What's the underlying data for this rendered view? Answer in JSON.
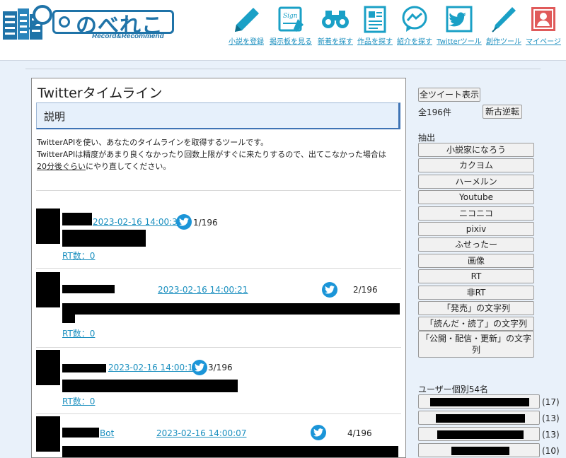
{
  "header": {
    "logo_title": "のべれこ",
    "logo_sub": "Record&Recommend",
    "nav": [
      {
        "label": "小説を登録",
        "icon": "pencil-icon"
      },
      {
        "label": "掲示板を見る",
        "icon": "signboard-icon"
      },
      {
        "label": "新着を探す",
        "icon": "binoculars-icon"
      },
      {
        "label": "作品を探す",
        "icon": "document-icon"
      },
      {
        "label": "紹介を探す",
        "icon": "messenger-icon"
      },
      {
        "label": "Twitterツール",
        "icon": "twitter-icon"
      },
      {
        "label": "創作ツール",
        "icon": "pen-icon"
      },
      {
        "label": "マイページ",
        "icon": "user-icon"
      }
    ]
  },
  "main": {
    "title": "Twitterタイムライン",
    "section_title": "説明",
    "desc_line1": "TwitterAPIを使い、あなたのタイムラインを取得するツールです。",
    "desc_line2": "TwitterAPIは精度があまり良くなかったり回数上限がすぐに来たりするので、出てこなかった場合は",
    "desc_link": "20分後ぐらい",
    "desc_line3": "にやり直してください。",
    "tweets": [
      {
        "date": "2023-02-16 14:00:32",
        "count": "1/196",
        "rt": "RT数：0"
      },
      {
        "date": "2023-02-16 14:00:21",
        "count": "2/196",
        "rt": "RT数：0"
      },
      {
        "date": "2023-02-16 14:00:18",
        "count": "3/196",
        "rt": "RT数：0"
      },
      {
        "date": "2023-02-16 14:00:07",
        "count": "4/196",
        "user_suffix": "Bot"
      }
    ]
  },
  "sidebar": {
    "show_all": "全ツイート表示",
    "total": "全196件",
    "reverse": "新古逆転",
    "filter_heading": "抽出",
    "filters": [
      "小説家になろう",
      "カクヨム",
      "ハーメルン",
      "Youtube",
      "ニコニコ",
      "pixiv",
      "ふせったー",
      "画像",
      "RT",
      "非RT",
      "「発売」の文字列",
      "「読んだ・読了」の文字列"
    ],
    "filter_last_line1": "「公開・配信・更新」の文字",
    "filter_last_line2": "列",
    "users_heading": "ユーザー個別54名",
    "users": [
      {
        "count": "(17)"
      },
      {
        "count": "(13)"
      },
      {
        "count": "(13)"
      },
      {
        "count": "(10)"
      }
    ]
  },
  "colors": {
    "accent": "#1a8fbf",
    "logo": "#1f73a8",
    "twitter": "#1b95d8",
    "section_border": "#3f74b5"
  }
}
